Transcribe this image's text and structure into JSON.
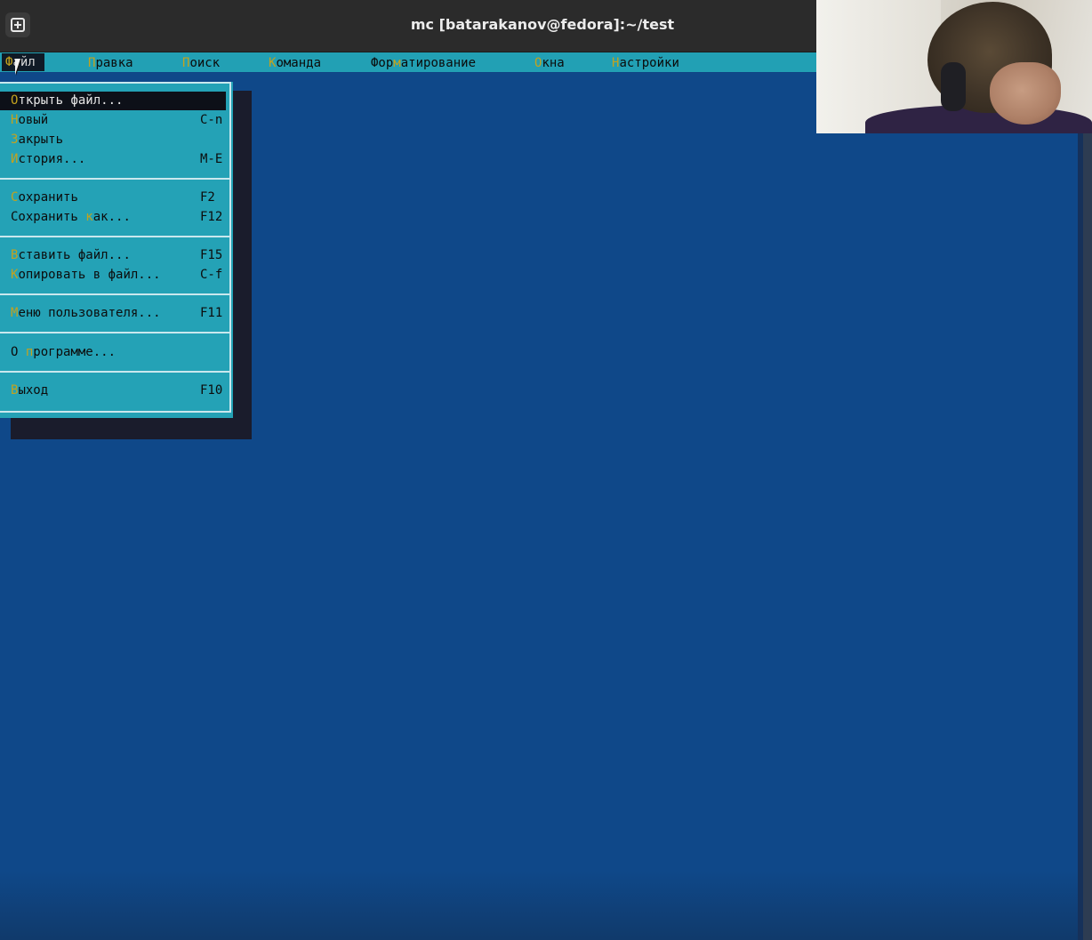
{
  "window": {
    "title": "mc [batarakanov@fedora]:~/test",
    "new_tab_icon": "plus-box-icon"
  },
  "menubar": {
    "items": [
      {
        "hot": "Ф",
        "rest": "айл"
      },
      {
        "hot": "П",
        "rest": "равка"
      },
      {
        "hot": "П",
        "rest": "оиск"
      },
      {
        "hot": "К",
        "rest": "оманда"
      },
      {
        "pre": "Фор",
        "hot": "м",
        "rest": "атирование"
      },
      {
        "hot": "О",
        "rest": "кна"
      },
      {
        "hot": "Н",
        "rest": "астройки"
      }
    ]
  },
  "file_menu": {
    "items": [
      {
        "pre": "",
        "hot": "О",
        "rest": "ткрыть файл...",
        "shortcut": ""
      },
      {
        "pre": "",
        "hot": "Н",
        "rest": "овый",
        "shortcut": "C-n"
      },
      {
        "pre": "",
        "hot": "З",
        "rest": "акрыть",
        "shortcut": ""
      },
      {
        "pre": "",
        "hot": "И",
        "rest": "стория...",
        "shortcut": "M-E"
      },
      {
        "pre": "",
        "hot": "С",
        "rest": "охранить",
        "shortcut": "F2"
      },
      {
        "pre": "Сохранить ",
        "hot": "к",
        "rest": "ак...",
        "shortcut": "F12"
      },
      {
        "pre": "",
        "hot": "В",
        "rest": "ставить файл...",
        "shortcut": "F15"
      },
      {
        "pre": "",
        "hot": "К",
        "rest": "опировать в файл...",
        "shortcut": "C-f"
      },
      {
        "pre": "",
        "hot": "М",
        "rest": "еню пользователя...",
        "shortcut": "F11"
      },
      {
        "pre": "О ",
        "hot": "п",
        "rest": "рограмме...",
        "shortcut": ""
      },
      {
        "pre": "",
        "hot": "В",
        "rest": "ыход",
        "shortcut": "F10"
      }
    ]
  },
  "colors": {
    "editor_bg": "#0f4585",
    "menu_bg": "#24a2b6",
    "hotkey": "#c3a21e",
    "selected_bg": "#0d1018"
  }
}
